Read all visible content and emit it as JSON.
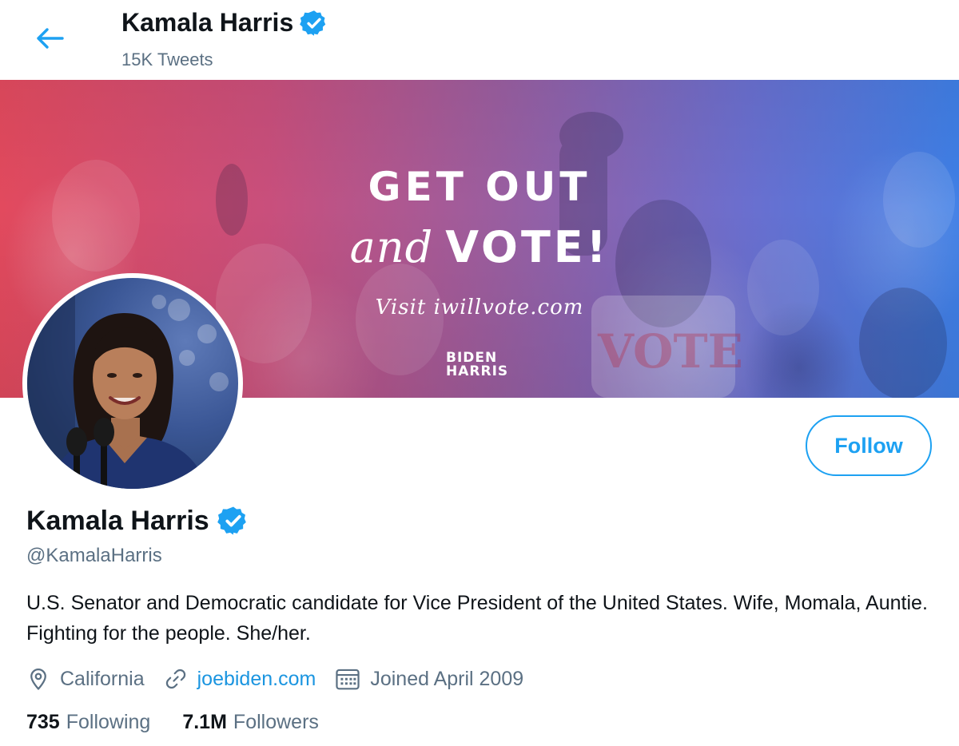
{
  "header": {
    "name": "Kamala Harris",
    "tweet_count": "15K Tweets"
  },
  "banner": {
    "line1": "GET OUT",
    "line2_italic": "and",
    "line2_bold": "VOTE!",
    "visit": "Visit iwillvote.com",
    "logo_top": "BIDEN",
    "logo_bottom": "HARRIS"
  },
  "actions": {
    "follow_label": "Follow"
  },
  "profile": {
    "name": "Kamala Harris",
    "handle": "@KamalaHarris",
    "bio": "U.S. Senator and Democratic candidate for Vice President of the United States. Wife, Momala, Auntie. Fighting for the people. She/her.",
    "location": "California",
    "website": "joebiden.com",
    "joined": "Joined April 2009"
  },
  "stats": {
    "following_count": "735",
    "following_label": "Following",
    "followers_count": "7.1M",
    "followers_label": "Followers"
  },
  "colors": {
    "accent": "#1da1f2",
    "link": "#1b95e0",
    "secondary_text": "#5b7083"
  },
  "icons": [
    "back-arrow-icon",
    "verified-badge-icon",
    "location-pin-icon",
    "link-icon",
    "calendar-icon"
  ]
}
